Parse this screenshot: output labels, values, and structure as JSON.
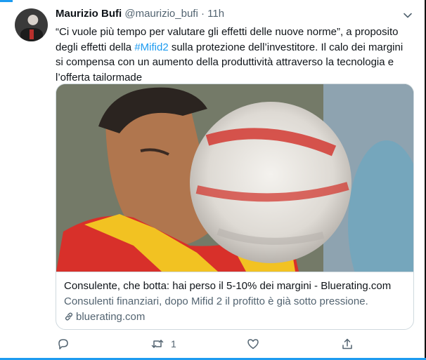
{
  "tweet": {
    "author_name": "Maurizio Bufi",
    "author_handle": "@maurizio_bufi",
    "separator": "·",
    "time": "11h",
    "text_before_link": "“Ci vuole più tempo per valutare gli effetti delle nuove norme”, a proposito degli effetti della ",
    "hashtag": "#Mifid2",
    "text_after_link": " sulla protezione dell’investitore. Il calo dei margini si compensa con un aumento della produttività attraverso la tecnologia e l’offerta tailormade"
  },
  "card": {
    "title": "Consulente, che botta: hai perso il 5-10% dei margini - Bluerating.com",
    "description": "Consulenti finanziari, dopo Mifid 2 il profitto è già sotto pressione.",
    "domain": "bluerating.com"
  },
  "actions": {
    "reply_count": "",
    "retweet_count": "1",
    "like_count": "",
    "share_count": ""
  },
  "colors": {
    "accent": "#1d9bf0",
    "text_primary": "#0f1419",
    "text_secondary": "#536471",
    "border": "#cfd9de"
  },
  "icons": [
    "chevron-down-icon",
    "link-icon",
    "reply-icon",
    "retweet-icon",
    "like-icon",
    "share-icon"
  ]
}
